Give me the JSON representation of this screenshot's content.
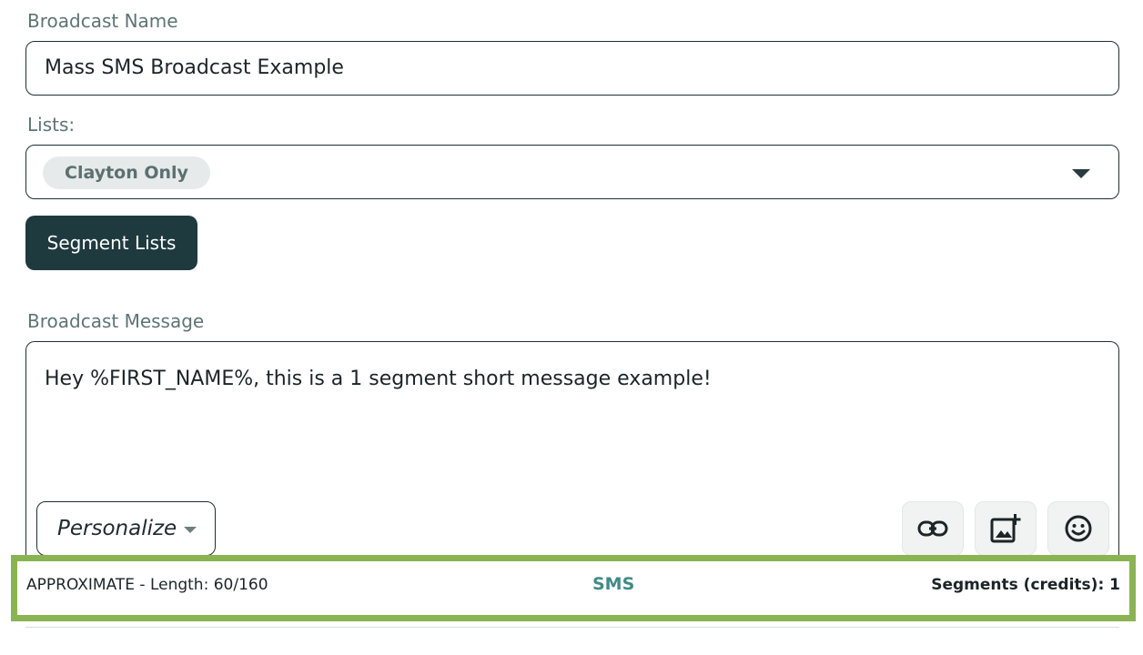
{
  "broadcast_name": {
    "label": "Broadcast Name",
    "value": "Mass SMS Broadcast Example"
  },
  "lists": {
    "label": "Lists:",
    "chips": [
      "Clayton Only"
    ]
  },
  "segment_button": {
    "label": "Segment Lists"
  },
  "message": {
    "label": "Broadcast Message",
    "text": "Hey %FIRST_NAME%, this is a 1 segment short message example!",
    "personalize_label": "Personalize",
    "tools": [
      "link-icon",
      "add-image-icon",
      "emoji-icon"
    ]
  },
  "status": {
    "length_text": "APPROXIMATE - Length: 60/160",
    "type": "SMS",
    "segments_text": "Segments (credits): 1",
    "highlight_color": "#8ab452"
  }
}
